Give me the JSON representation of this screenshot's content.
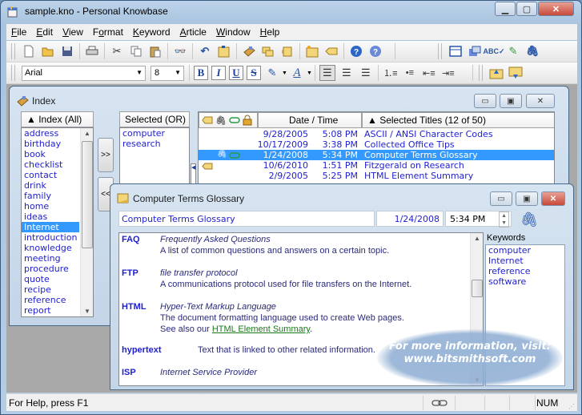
{
  "app": {
    "title": "sample.kno - Personal Knowbase",
    "caption_buttons": {
      "minimize": "minimize-icon",
      "maximize": "maximize-icon",
      "close": "close-icon"
    }
  },
  "menu": [
    {
      "label": "File",
      "key": "F",
      "rest": "ile"
    },
    {
      "label": "Edit",
      "key": "E",
      "rest": "dit"
    },
    {
      "label": "View",
      "key": "V",
      "rest": "iew"
    },
    {
      "label": "Format",
      "pre": "F",
      "key": "o",
      "rest": "rmat"
    },
    {
      "label": "Keyword",
      "key": "K",
      "rest": "eyword"
    },
    {
      "label": "Article",
      "key": "A",
      "rest": "rticle"
    },
    {
      "label": "Window",
      "key": "W",
      "rest": "indow"
    },
    {
      "label": "Help",
      "key": "H",
      "rest": "elp"
    }
  ],
  "toolbar1": {
    "icons": [
      "new-icon",
      "open-icon",
      "save-icon",
      "print-icon",
      "cut-icon",
      "copy-icon",
      "paste-icon",
      "find-icon",
      "undo-icon",
      "edit-article-icon",
      "index-icon",
      "windows-icon",
      "keyword-icon",
      "new-article-icon",
      "tag-icon",
      "help-icon",
      "context-help-icon",
      "layout-icon",
      "properties-icon",
      "spellcheck-icon",
      "link-icon",
      "attachment-icon"
    ]
  },
  "toolbar2": {
    "font": "Arial",
    "size": "8",
    "bold": "B",
    "italic": "I",
    "underline": "U",
    "strike": "S",
    "highlight": "✎",
    "font_color": "A"
  },
  "index_window": {
    "title": "Index",
    "index_header": "▲ Index (All)",
    "index_items": [
      "address",
      "birthday",
      "book",
      "checklist",
      "contact",
      "drink",
      "family",
      "home",
      "ideas",
      "Internet",
      "introduction",
      "knowledge",
      "meeting",
      "procedure",
      "quote",
      "recipe",
      "reference",
      "report"
    ],
    "index_selected": "Internet",
    "add_button": ">>",
    "remove_button": "<<",
    "selected_header": "Selected (OR)",
    "selected_items": [
      "computer",
      "research"
    ],
    "date_header": "Date / Time",
    "titles_header": "▲ Selected Titles (12 of 50)",
    "articles": [
      {
        "date": "9/28/2005",
        "time": "5:08 PM",
        "title": "ASCII / ANSI Character Codes",
        "attach": false,
        "link": false,
        "tag": false,
        "selected": false
      },
      {
        "date": "10/17/2009",
        "time": "3:38 PM",
        "title": "Collected Office Tips",
        "attach": false,
        "link": false,
        "tag": false,
        "selected": false
      },
      {
        "date": "1/24/2008",
        "time": "5:34 PM",
        "title": "Computer Terms Glossary",
        "attach": true,
        "link": true,
        "tag": false,
        "selected": true
      },
      {
        "date": "10/6/2010",
        "time": "1:51 PM",
        "title": "Fitzgerald on Research",
        "attach": false,
        "link": false,
        "tag": true,
        "selected": false
      },
      {
        "date": "2/9/2005",
        "time": "5:25 PM",
        "title": "HTML Element Summary",
        "attach": false,
        "link": false,
        "tag": false,
        "selected": false
      }
    ]
  },
  "article_window": {
    "title": "Computer Terms Glossary",
    "title_field": "Computer Terms Glossary",
    "date_field": "1/24/2008",
    "time_field": "5:34 PM",
    "keywords_label": "Keywords",
    "keywords": [
      "computer",
      "Internet",
      "reference",
      "software"
    ],
    "glossary": [
      {
        "term": "FAQ",
        "definition": "Frequently Asked Questions",
        "text": "A list of common questions and answers on a certain topic."
      },
      {
        "term": "FTP",
        "definition": "file transfer protocol",
        "text": "A communications protocol used for file transfers on the Internet."
      },
      {
        "term": "HTML",
        "definition": "Hyper-Text Markup Language",
        "text": "The document formatting language used to create Web pages.",
        "see_also_prefix": "See also our ",
        "see_also_link": "HTML Element Summary",
        "see_also_suffix": "."
      },
      {
        "term": "hypertext",
        "text": "Text that is linked to other related information."
      },
      {
        "term": "ISP",
        "definition": "Internet Service Provider"
      }
    ]
  },
  "promo": {
    "line1": "For more information, visit:",
    "line2": "www.bitsmithsoft.com"
  },
  "statusbar": {
    "help": "For Help, press F1",
    "num": "NUM"
  },
  "colors": {
    "selection": "#3399ff",
    "list_text": "#1e1ecf",
    "link": "#1a7a1a"
  }
}
